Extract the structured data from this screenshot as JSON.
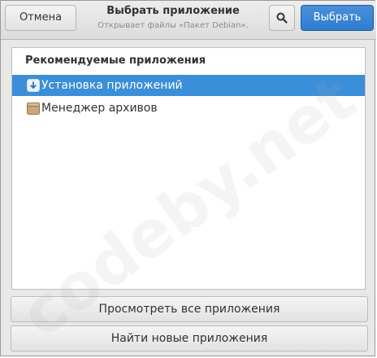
{
  "header": {
    "cancel_label": "Отмена",
    "title": "Выбрать приложение",
    "subtitle": "Открывает файлы «Пакет Debian».",
    "search_icon": "search-icon",
    "select_label": "Выбрать",
    "accent_color": "#3b8ed8"
  },
  "panel": {
    "section_title": "Рекомендуемые приложения",
    "apps": [
      {
        "label": "Установка приложений",
        "icon": "install-icon",
        "selected": true
      },
      {
        "label": "Менеджер архивов",
        "icon": "archive-icon",
        "selected": false
      }
    ]
  },
  "footer": {
    "view_all_label": "Просмотреть все приложения",
    "find_new_label": "Найти новые приложения"
  },
  "watermark": "codeby.net"
}
